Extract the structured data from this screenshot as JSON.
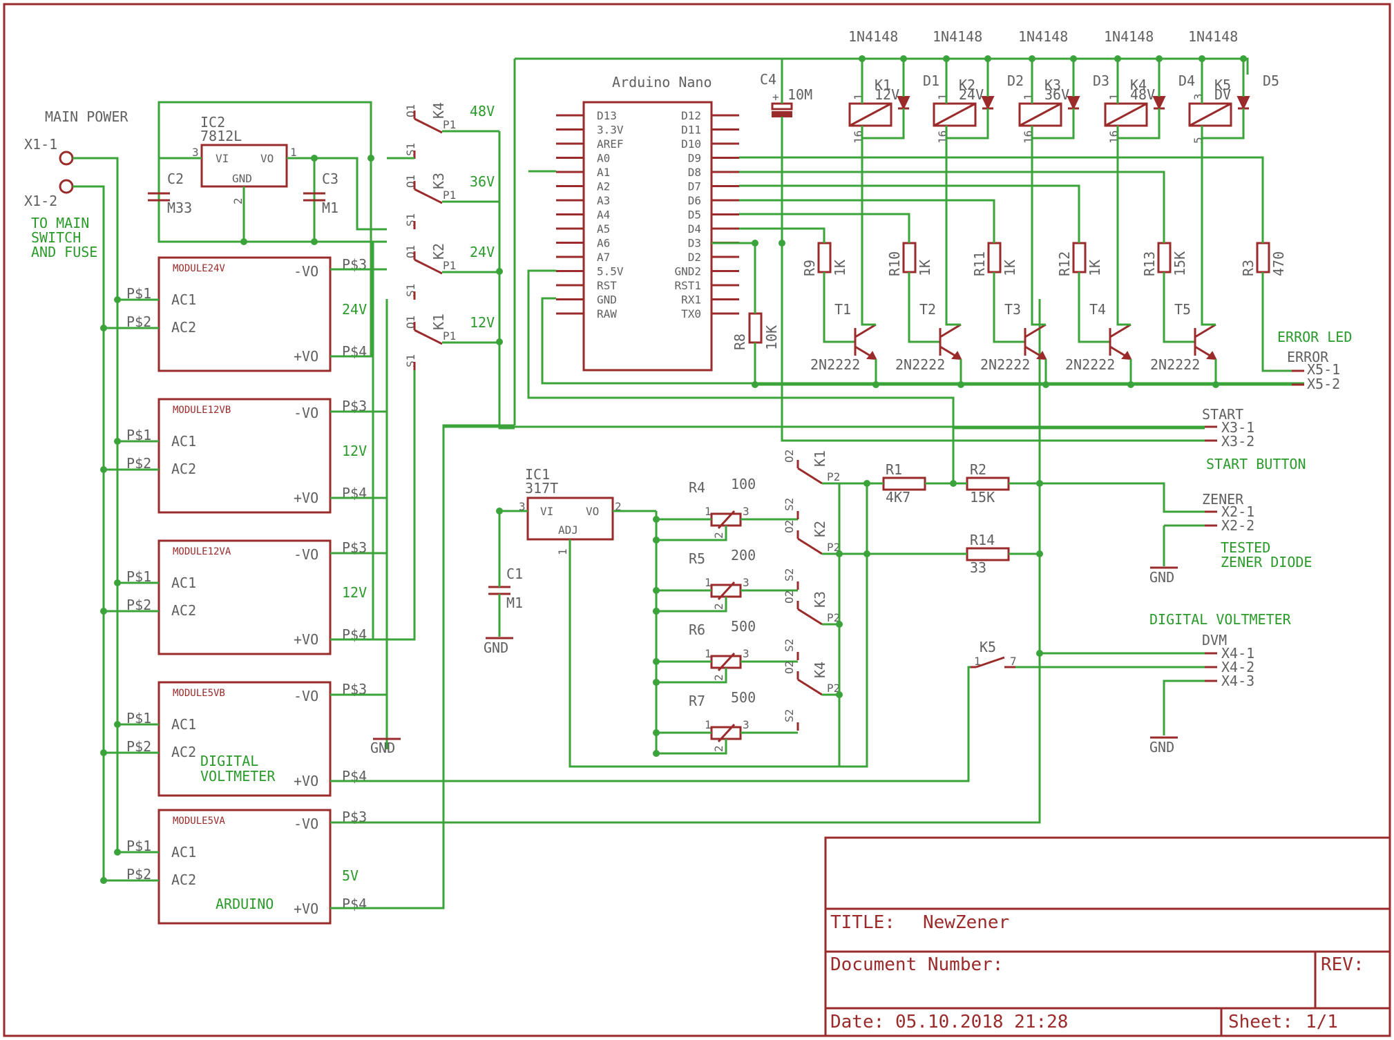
{
  "main_power": {
    "title": "MAIN POWER",
    "x1_1": "X1-1",
    "x1_2": "X1-2",
    "note_l1": "TO MAIN",
    "note_l2": "SWITCH",
    "note_l3": "AND FUSE"
  },
  "ic2": {
    "ref": "IC2",
    "part": "7812L",
    "vi": "VI",
    "vo": "VO",
    "gnd": "GND",
    "pin1": "1",
    "pin2": "2",
    "pin3": "3"
  },
  "c2": {
    "ref": "C2",
    "value": "M33"
  },
  "c3": {
    "ref": "C3",
    "value": "M1"
  },
  "modules": [
    {
      "name": "MODULE24V",
      "out": "24V",
      "label": ""
    },
    {
      "name": "MODULE12VB",
      "out": "12V",
      "label": ""
    },
    {
      "name": "MODULE12VA",
      "out": "12V",
      "label": ""
    },
    {
      "name": "MODULE5VB",
      "out": "",
      "label": "DIGITAL\nVOLTMETER",
      "label1": "DIGITAL",
      "label2": "VOLTMETER"
    },
    {
      "name": "MODULE5VA",
      "out": "5V",
      "label": "ARDUINO"
    }
  ],
  "module_pins": {
    "p1": "P$1",
    "p2": "P$2",
    "p3": "P$3",
    "p4": "P$4",
    "ac1": "AC1",
    "ac2": "AC2",
    "vneg": "-VO",
    "vpos": "+VO"
  },
  "relay_selector": [
    {
      "ref": "K4",
      "volt": "48V"
    },
    {
      "ref": "K3",
      "volt": "36V"
    },
    {
      "ref": "K2",
      "volt": "24V"
    },
    {
      "ref": "K1",
      "volt": "12V"
    }
  ],
  "contact_pins": {
    "o1": "O1",
    "s1": "S1",
    "p1": "P1",
    "o2": "O2",
    "s2": "S2",
    "p2": "P2"
  },
  "arduino": {
    "title": "Arduino Nano",
    "left_pins": [
      "D13",
      "3.3V",
      "AREF",
      "A0",
      "A1",
      "A2",
      "A3",
      "A4",
      "A5",
      "A6",
      "A7",
      "5.5V",
      "RST",
      "GND",
      "RAW"
    ],
    "right_pins": [
      "D12",
      "D11",
      "D10",
      "D9",
      "D8",
      "D7",
      "D6",
      "D5",
      "D4",
      "D3",
      "D2",
      "GND2",
      "RST1",
      "RX1",
      "TX0"
    ]
  },
  "c4": {
    "ref": "C4",
    "value": "10M",
    "plus": "+"
  },
  "relays": [
    {
      "ref": "K1",
      "volt": "12V",
      "diode": "D1",
      "diode_part": "1N4148",
      "pin_a": "1",
      "pin_b": "16"
    },
    {
      "ref": "K2",
      "volt": "24V",
      "diode": "D2",
      "diode_part": "1N4148",
      "pin_a": "1",
      "pin_b": "16"
    },
    {
      "ref": "K3",
      "volt": "36V",
      "diode": "D3",
      "diode_part": "1N4148",
      "pin_a": "1",
      "pin_b": "16"
    },
    {
      "ref": "K4",
      "volt": "48V",
      "diode": "D4",
      "diode_part": "1N4148",
      "pin_a": "1",
      "pin_b": "16"
    },
    {
      "ref": "K5",
      "volt": "DV",
      "diode": "D5",
      "diode_part": "1N4148",
      "pin_a": "3",
      "pin_b": "5"
    }
  ],
  "base_resistors": [
    {
      "ref": "R9",
      "value": "1K"
    },
    {
      "ref": "R10",
      "value": "1K"
    },
    {
      "ref": "R11",
      "value": "1K"
    },
    {
      "ref": "R12",
      "value": "1K"
    },
    {
      "ref": "R13",
      "value": "15K"
    },
    {
      "ref": "R3",
      "value": "470"
    }
  ],
  "transistors": [
    {
      "ref": "T1",
      "part": "2N2222"
    },
    {
      "ref": "T2",
      "part": "2N2222"
    },
    {
      "ref": "T3",
      "part": "2N2222"
    },
    {
      "ref": "T4",
      "part": "2N2222"
    },
    {
      "ref": "T5",
      "part": "2N2222"
    }
  ],
  "r8": {
    "ref": "R8",
    "value": "10K"
  },
  "connectors": {
    "error_title": "ERROR LED",
    "error": "ERROR",
    "x5_1": "X5-1",
    "x5_2": "X5-2",
    "start": "START",
    "x3_1": "X3-1",
    "x3_2": "X3-2",
    "start_title": "START BUTTON",
    "zener": "ZENER",
    "x2_1": "X2-1",
    "x2_2": "X2-2",
    "zener_title1": "TESTED",
    "zener_title2": "ZENER DIODE",
    "dvm_title": "DIGITAL VOLTMETER",
    "dvm": "DVM",
    "x4_1": "X4-1",
    "x4_2": "X4-2",
    "x4_3": "X4-3",
    "gnd": "GND"
  },
  "ic1": {
    "ref": "IC1",
    "part": "317T",
    "vi": "VI",
    "vo": "VO",
    "adj": "ADJ",
    "pin1": "1",
    "pin2": "2",
    "pin3": "3"
  },
  "c1": {
    "ref": "C1",
    "value": "M1"
  },
  "pots": [
    {
      "ref": "R4",
      "value": "100",
      "relay": "K1"
    },
    {
      "ref": "R5",
      "value": "200",
      "relay": "K2"
    },
    {
      "ref": "R6",
      "value": "500",
      "relay": "K3"
    },
    {
      "ref": "R7",
      "value": "500",
      "relay": "K4"
    }
  ],
  "pot_pins": {
    "a": "1",
    "b": "2",
    "c": "3"
  },
  "r1": {
    "ref": "R1",
    "value": "4K7"
  },
  "r2": {
    "ref": "R2",
    "value": "15K"
  },
  "r14": {
    "ref": "R14",
    "value": "33"
  },
  "k5": {
    "ref": "K5",
    "pin1": "1",
    "pin7": "7"
  },
  "title_block": {
    "title_label": "TITLE:",
    "title": "NewZener",
    "docnum_label": "Document Number:",
    "rev_label": "REV:",
    "date_label": "Date:",
    "date": "05.10.2018 21:28",
    "sheet_label": "Sheet:",
    "sheet": "1/1"
  },
  "colors": {
    "symbol": "#9b2a2a",
    "wire": "#3aa33a",
    "text": "#606060",
    "net_label": "#2a9a2a"
  }
}
